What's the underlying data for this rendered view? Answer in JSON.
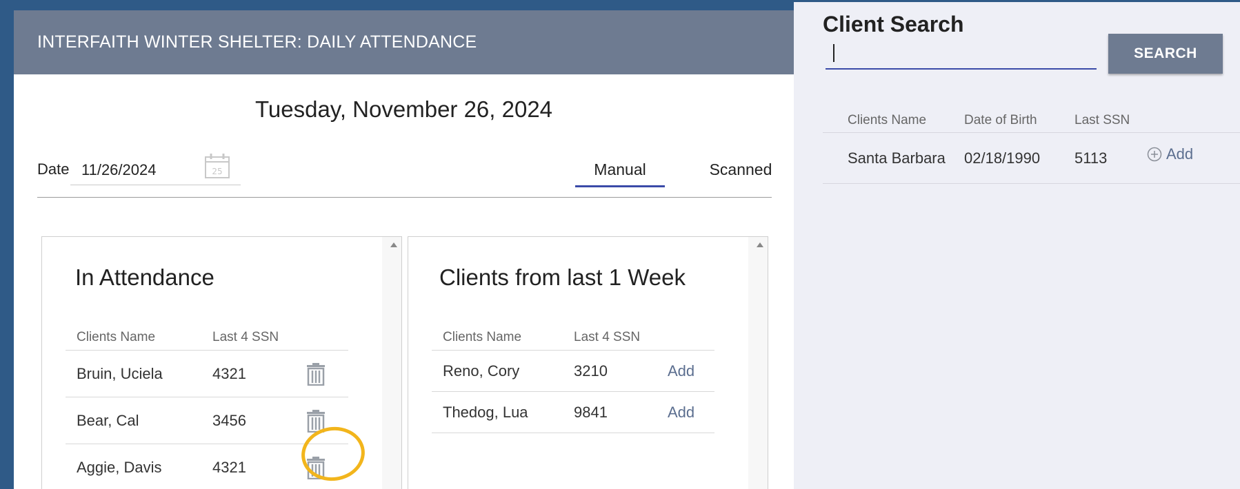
{
  "header": {
    "title": "INTERFAITH WINTER SHELTER: DAILY ATTENDANCE"
  },
  "date_heading": "Tuesday, November 26, 2024",
  "date_field": {
    "label": "Date",
    "value": "11/26/2024",
    "calendar_day": "25"
  },
  "tabs": {
    "manual": "Manual",
    "scanned": "Scanned",
    "active": "Manual"
  },
  "attendance": {
    "title": "In Attendance",
    "columns": [
      "Clients Name",
      "Last 4 SSN"
    ],
    "rows": [
      {
        "name": "Bruin, Uciela",
        "ssn": "4321"
      },
      {
        "name": "Bear, Cal",
        "ssn": "3456"
      },
      {
        "name": "Aggie, Davis",
        "ssn": "4321"
      }
    ]
  },
  "recent": {
    "title": "Clients from last 1 Week",
    "columns": [
      "Clients Name",
      "Last 4 SSN"
    ],
    "add_label": "Add",
    "rows": [
      {
        "name": "Reno, Cory",
        "ssn": "3210"
      },
      {
        "name": "Thedog, Lua",
        "ssn": "9841"
      }
    ]
  },
  "search": {
    "title": "Client Search",
    "input_value": "",
    "button_label": "SEARCH",
    "columns": [
      "Clients Name",
      "Date of Birth",
      "Last SSN"
    ],
    "add_label": "Add",
    "results": [
      {
        "name": "Santa Barbara",
        "dob": "02/18/1990",
        "ssn": "5113"
      }
    ]
  },
  "colors": {
    "header_bg": "#6e7b91",
    "accent": "#3a4aa8",
    "page_bg": "#2f5a87",
    "highlight": "#f2b51c",
    "link": "#5b6e8f"
  }
}
